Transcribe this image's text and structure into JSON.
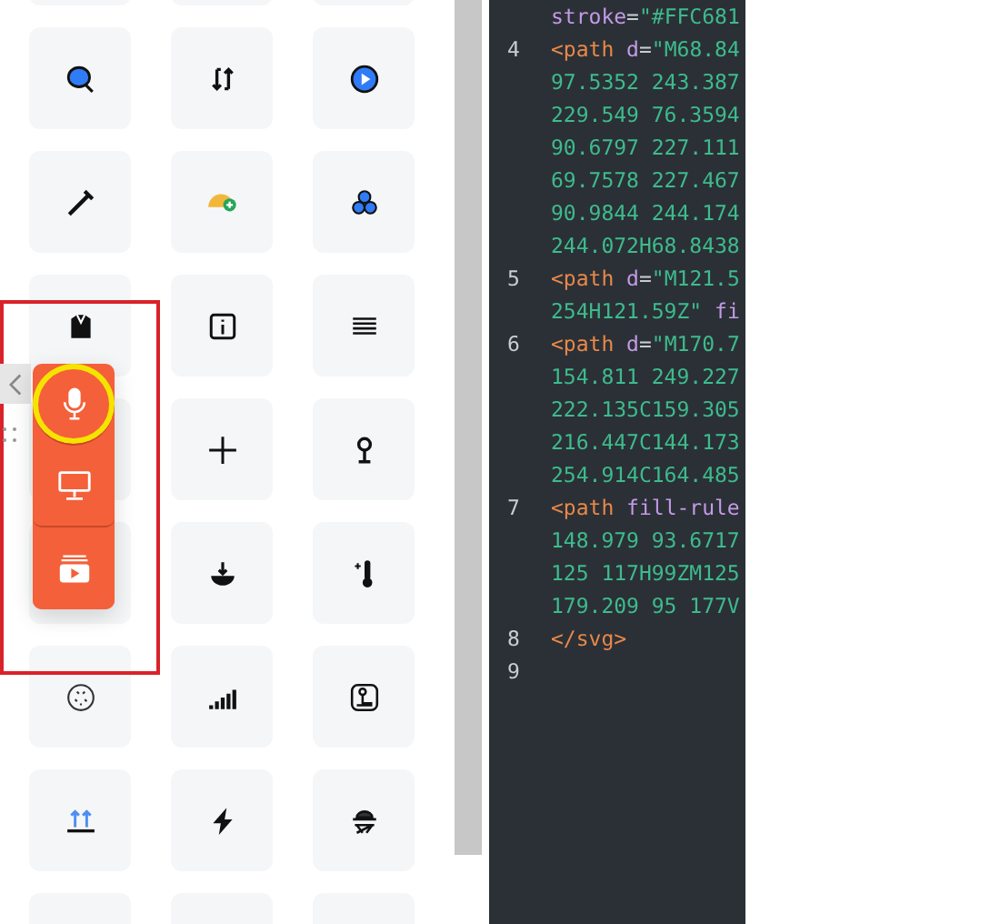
{
  "floating_toolbar": {
    "buttons": [
      {
        "kind": "microphone",
        "selected": true
      },
      {
        "kind": "monitor",
        "selected": false
      },
      {
        "kind": "video-folder",
        "selected": false
      }
    ]
  },
  "code_editor": {
    "lines": [
      {
        "tokens": [
          {
            "kind": "attr",
            "text": "stroke"
          },
          {
            "kind": "punct",
            "text": "="
          },
          {
            "kind": "string",
            "text": "\"#FFC681"
          }
        ]
      },
      {
        "number": "4",
        "tokens": [
          {
            "kind": "tag",
            "text": "<path"
          },
          {
            "kind": "attr",
            "text": " d"
          },
          {
            "kind": "punct",
            "text": "="
          },
          {
            "kind": "string",
            "text": "\"M68.84"
          }
        ]
      },
      {
        "tokens": [
          {
            "kind": "string",
            "text": "97.5352 243.387"
          }
        ]
      },
      {
        "tokens": [
          {
            "kind": "string",
            "text": "229.549 76.3594"
          }
        ]
      },
      {
        "tokens": [
          {
            "kind": "string",
            "text": "90.6797 227.111"
          }
        ]
      },
      {
        "tokens": [
          {
            "kind": "string",
            "text": "69.7578 227.467"
          }
        ]
      },
      {
        "tokens": [
          {
            "kind": "string",
            "text": "90.9844 244.174"
          }
        ]
      },
      {
        "tokens": [
          {
            "kind": "string",
            "text": "244.072H68.8438"
          }
        ]
      },
      {
        "number": "5",
        "tokens": [
          {
            "kind": "tag",
            "text": "<path"
          },
          {
            "kind": "attr",
            "text": " d"
          },
          {
            "kind": "punct",
            "text": "="
          },
          {
            "kind": "string",
            "text": "\"M121.5"
          }
        ]
      },
      {
        "tokens": [
          {
            "kind": "string",
            "text": "254H121.59Z\""
          },
          {
            "kind": "attr",
            "text": " fi"
          }
        ]
      },
      {
        "number": "6",
        "tokens": [
          {
            "kind": "tag",
            "text": "<path"
          },
          {
            "kind": "attr",
            "text": " d"
          },
          {
            "kind": "punct",
            "text": "="
          },
          {
            "kind": "string",
            "text": "\"M170.7"
          }
        ]
      },
      {
        "tokens": [
          {
            "kind": "string",
            "text": "154.811 249.227"
          }
        ]
      },
      {
        "tokens": [
          {
            "kind": "string",
            "text": "222.135C159.305"
          }
        ]
      },
      {
        "tokens": [
          {
            "kind": "string",
            "text": "216.447C144.173"
          }
        ]
      },
      {
        "tokens": [
          {
            "kind": "string",
            "text": "254.914C164.485"
          }
        ]
      },
      {
        "number": "7",
        "tokens": [
          {
            "kind": "tag",
            "text": "<path"
          },
          {
            "kind": "attr",
            "text": " fill-rule"
          }
        ]
      },
      {
        "tokens": [
          {
            "kind": "string",
            "text": "148.979 93.6717"
          }
        ]
      },
      {
        "tokens": [
          {
            "kind": "string",
            "text": "125 117H99ZM125"
          }
        ]
      },
      {
        "tokens": [
          {
            "kind": "string",
            "text": "179.209 95 177V"
          }
        ]
      },
      {
        "number": "8",
        "tokens": [
          {
            "kind": "tag",
            "text": "</svg>"
          }
        ]
      },
      {
        "number": "9"
      }
    ]
  }
}
